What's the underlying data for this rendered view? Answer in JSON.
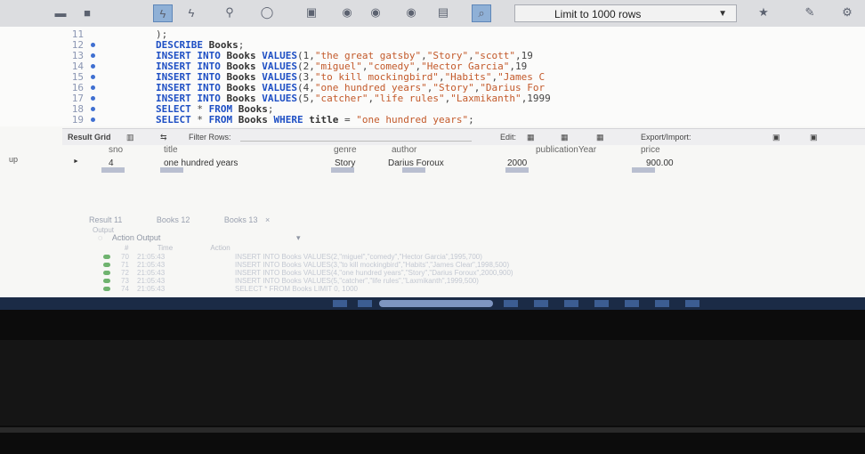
{
  "toolbar": {
    "limit_label": "Limit to 1000 rows",
    "icons": [
      "open-sql-icon",
      "save-icon",
      "execute-icon",
      "execute-current-icon",
      "explain-icon",
      "stop-icon",
      "toggle-icon",
      "commit-icon",
      "rollback-icon",
      "auto-commit-icon",
      "beautify-icon",
      "find-icon"
    ]
  },
  "editor": {
    "lines": [
      {
        "num": "11",
        "code": [
          {
            "t": "pn",
            "v": ");"
          }
        ]
      },
      {
        "num": "12",
        "code": [
          {
            "t": "kw",
            "v": "DESCRIBE "
          },
          {
            "t": "id",
            "v": "Books"
          },
          {
            "t": "pn",
            "v": ";"
          }
        ]
      },
      {
        "num": "13",
        "code": [
          {
            "t": "kw",
            "v": "INSERT INTO "
          },
          {
            "t": "id",
            "v": "Books "
          },
          {
            "t": "kw",
            "v": "VALUES"
          },
          {
            "t": "pn",
            "v": "(1,"
          },
          {
            "t": "str",
            "v": "\"the great gatsby\""
          },
          {
            "t": "pn",
            "v": ","
          },
          {
            "t": "str",
            "v": "\"Story\""
          },
          {
            "t": "pn",
            "v": ","
          },
          {
            "t": "str",
            "v": "\"scott\""
          },
          {
            "t": "pn",
            "v": ",19"
          }
        ]
      },
      {
        "num": "14",
        "code": [
          {
            "t": "kw",
            "v": "INSERT INTO "
          },
          {
            "t": "id",
            "v": "Books "
          },
          {
            "t": "kw",
            "v": "VALUES"
          },
          {
            "t": "pn",
            "v": "(2,"
          },
          {
            "t": "str",
            "v": "\"miguel\""
          },
          {
            "t": "pn",
            "v": ","
          },
          {
            "t": "str",
            "v": "\"comedy\""
          },
          {
            "t": "pn",
            "v": ","
          },
          {
            "t": "str",
            "v": "\"Hector Garcia\""
          },
          {
            "t": "pn",
            "v": ",19"
          }
        ]
      },
      {
        "num": "15",
        "code": [
          {
            "t": "kw",
            "v": "INSERT INTO "
          },
          {
            "t": "id",
            "v": "Books "
          },
          {
            "t": "kw",
            "v": "VALUES"
          },
          {
            "t": "pn",
            "v": "(3,"
          },
          {
            "t": "str",
            "v": "\"to kill mockingbird\""
          },
          {
            "t": "pn",
            "v": ","
          },
          {
            "t": "str",
            "v": "\"Habits\""
          },
          {
            "t": "pn",
            "v": ","
          },
          {
            "t": "str",
            "v": "\"James C"
          }
        ]
      },
      {
        "num": "16",
        "code": [
          {
            "t": "kw",
            "v": "INSERT INTO "
          },
          {
            "t": "id",
            "v": "Books "
          },
          {
            "t": "kw",
            "v": "VALUES"
          },
          {
            "t": "pn",
            "v": "(4,"
          },
          {
            "t": "str",
            "v": "\"one hundred years\""
          },
          {
            "t": "pn",
            "v": ","
          },
          {
            "t": "str",
            "v": "\"Story\""
          },
          {
            "t": "pn",
            "v": ","
          },
          {
            "t": "str",
            "v": "\"Darius For"
          }
        ]
      },
      {
        "num": "17",
        "code": [
          {
            "t": "kw",
            "v": "INSERT INTO "
          },
          {
            "t": "id",
            "v": "Books "
          },
          {
            "t": "kw",
            "v": "VALUES"
          },
          {
            "t": "pn",
            "v": "(5,"
          },
          {
            "t": "str",
            "v": "\"catcher\""
          },
          {
            "t": "pn",
            "v": ","
          },
          {
            "t": "str",
            "v": "\"life rules\""
          },
          {
            "t": "pn",
            "v": ","
          },
          {
            "t": "str",
            "v": "\"Laxmikanth\""
          },
          {
            "t": "pn",
            "v": ",1999"
          }
        ]
      },
      {
        "num": "18",
        "code": [
          {
            "t": "kw",
            "v": "SELECT "
          },
          {
            "t": "pn",
            "v": "* "
          },
          {
            "t": "kw",
            "v": "FROM "
          },
          {
            "t": "id",
            "v": "Books"
          },
          {
            "t": "pn",
            "v": ";"
          }
        ]
      },
      {
        "num": "19",
        "code": [
          {
            "t": "kw",
            "v": "SELECT "
          },
          {
            "t": "pn",
            "v": "* "
          },
          {
            "t": "kw",
            "v": "FROM "
          },
          {
            "t": "id",
            "v": "Books "
          },
          {
            "t": "kw",
            "v": "WHERE "
          },
          {
            "t": "id",
            "v": "title "
          },
          {
            "t": "pn",
            "v": "= "
          },
          {
            "t": "str",
            "v": "\"one hundred years\""
          },
          {
            "t": "pn",
            "v": ";"
          }
        ]
      }
    ]
  },
  "result_toolbar": {
    "grid_label": "Result Grid",
    "filter_label": "Filter Rows:",
    "edit_label": "Edit:",
    "export_label": "Export/Import:"
  },
  "grid": {
    "columns": [
      "sno",
      "title",
      "genre",
      "author",
      "publicationYear",
      "price"
    ],
    "rows": [
      [
        "4",
        "one hundred years",
        "Story",
        "Darius Foroux",
        "2000",
        "900.00"
      ]
    ]
  },
  "side_label": "up",
  "output": {
    "tabs": [
      "Result 11",
      "Books 12",
      "Books 13"
    ],
    "panel_title": "Output",
    "section_label": "Action Output",
    "columns": [
      "#",
      "Time",
      "Action"
    ],
    "rows": [
      {
        "num": "70",
        "time": "21:05:43",
        "action": "INSERT INTO Books VALUES(2,\"miguel\",\"comedy\",\"Hector Garcia\",1995,700)"
      },
      {
        "num": "71",
        "time": "21:05:43",
        "action": "INSERT INTO Books VALUES(3,\"to kill mockingbird\",\"Habits\",\"James Clear\",1998,500)"
      },
      {
        "num": "72",
        "time": "21:05:43",
        "action": "INSERT INTO Books VALUES(4,\"one hundred years\",\"Story\",\"Darius Foroux\",2000,900)"
      },
      {
        "num": "73",
        "time": "21:05:43",
        "action": "INSERT INTO Books VALUES(5,\"catcher\",\"life rules\",\"Laxmikanth\",1999,500)"
      },
      {
        "num": "74",
        "time": "21:05:43",
        "action": "SELECT * FROM Books LIMIT 0, 1000"
      }
    ]
  },
  "colors": {
    "keyword": "#1e4fc4",
    "string": "#c35a2b",
    "taskbar": "#1b2b46"
  }
}
